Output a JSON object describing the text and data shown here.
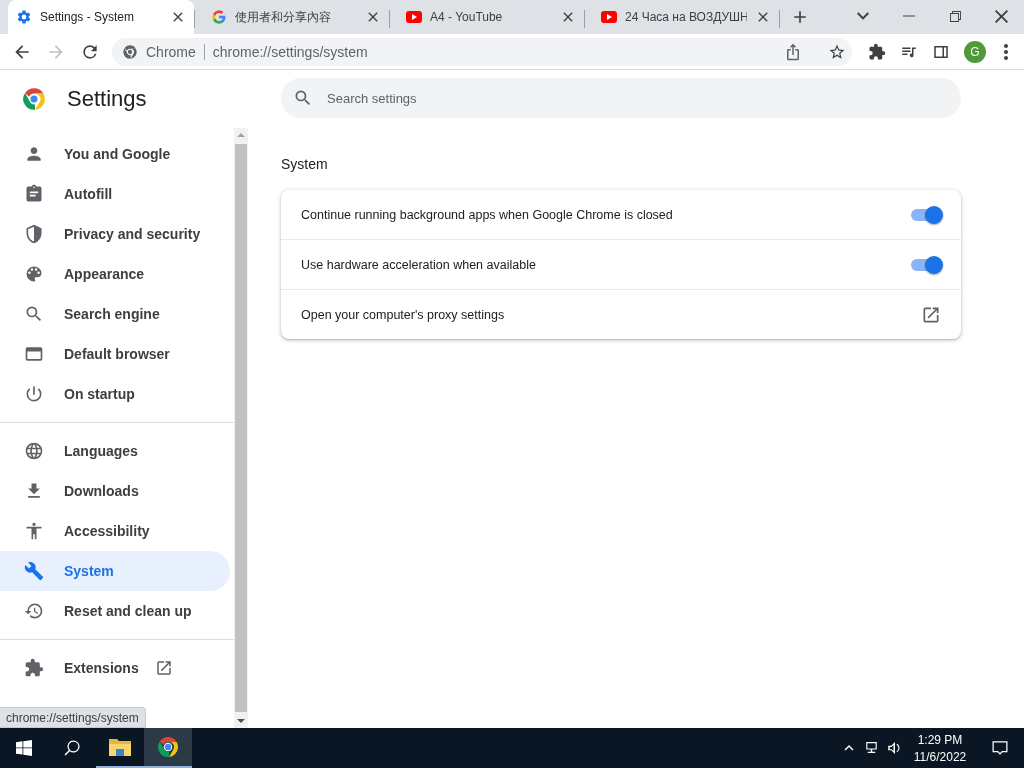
{
  "tabs": [
    {
      "title": "Settings - System",
      "selected": true
    },
    {
      "title": "使用者和分享內容",
      "selected": false
    },
    {
      "title": "A4 - YouTube",
      "selected": false
    },
    {
      "title": "24 Часа на ВОЗДУШН",
      "selected": false
    }
  ],
  "toolbar": {
    "site_label": "Chrome",
    "url": "chrome://settings/system",
    "profile_initial": "G"
  },
  "sidebar": {
    "title": "Settings",
    "groups": [
      {
        "items": [
          {
            "label": "You and Google",
            "selected": false
          },
          {
            "label": "Autofill",
            "selected": false
          },
          {
            "label": "Privacy and security",
            "selected": false
          },
          {
            "label": "Appearance",
            "selected": false
          },
          {
            "label": "Search engine",
            "selected": false
          },
          {
            "label": "Default browser",
            "selected": false
          },
          {
            "label": "On startup",
            "selected": false
          }
        ]
      },
      {
        "items": [
          {
            "label": "Languages",
            "selected": false
          },
          {
            "label": "Downloads",
            "selected": false
          },
          {
            "label": "Accessibility",
            "selected": false
          },
          {
            "label": "System",
            "selected": true
          },
          {
            "label": "Reset and clean up",
            "selected": false
          }
        ]
      },
      {
        "items": [
          {
            "label": "Extensions",
            "selected": false
          }
        ]
      }
    ]
  },
  "main": {
    "search": {
      "placeholder": "Search settings"
    },
    "section_title": "System",
    "rows": [
      {
        "kind": "toggle",
        "label": "Continue running background apps when Google Chrome is closed",
        "on": true
      },
      {
        "kind": "toggle",
        "label": "Use hardware acceleration when available",
        "on": true
      },
      {
        "kind": "link",
        "label": "Open your computer's proxy settings"
      }
    ]
  },
  "status_bubble": "chrome://settings/system",
  "taskbar": {
    "time": "1:29 PM",
    "date": "11/6/2022"
  }
}
